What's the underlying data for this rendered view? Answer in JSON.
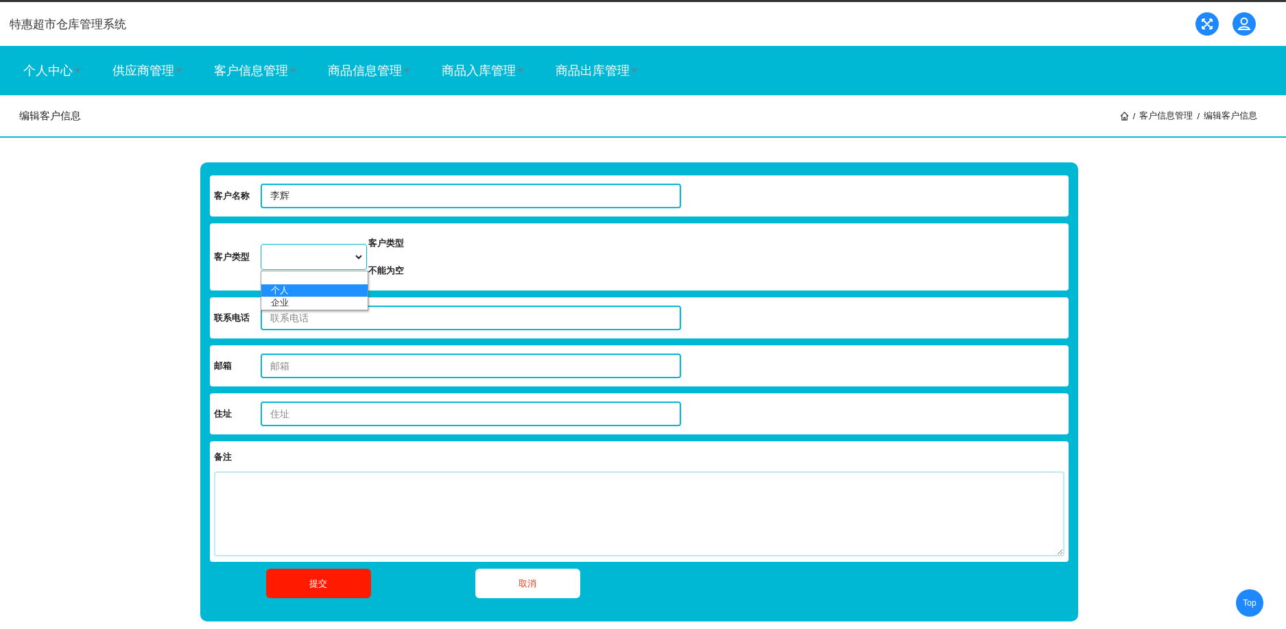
{
  "header": {
    "title": "特惠超市仓库管理系统"
  },
  "nav": [
    {
      "label": "个人中心"
    },
    {
      "label": "供应商管理"
    },
    {
      "label": "客户信息管理"
    },
    {
      "label": "商品信息管理"
    },
    {
      "label": "商品入库管理"
    },
    {
      "label": "商品出库管理"
    }
  ],
  "page_title": "编辑客户信息",
  "breadcrumb": [
    {
      "separator": "/",
      "label": "客户信息管理"
    },
    {
      "separator": "/",
      "label": "编辑客户信息"
    }
  ],
  "form": {
    "fields": [
      {
        "kind": "input",
        "label": "客户名称",
        "value": "李辉"
      },
      {
        "kind": "select",
        "label": "客户类型",
        "error": [
          "客户类型",
          "不能为空"
        ],
        "options": [
          {
            "selected": false
          },
          {
            "label": "个人",
            "selected": true
          },
          {
            "label": "企业",
            "selected": false
          }
        ]
      },
      {
        "kind": "input",
        "label": "联系电话",
        "placeholder": "联系电话"
      },
      {
        "kind": "input",
        "label": "邮箱",
        "placeholder": "邮箱"
      },
      {
        "kind": "input",
        "label": "住址",
        "placeholder": "住址"
      },
      {
        "kind": "textarea",
        "label": "备注"
      }
    ],
    "buttons": [
      {
        "label": "提交",
        "kind": "primary"
      },
      {
        "label": "取消",
        "kind": "secondary"
      }
    ]
  },
  "back_to_top": "Top"
}
